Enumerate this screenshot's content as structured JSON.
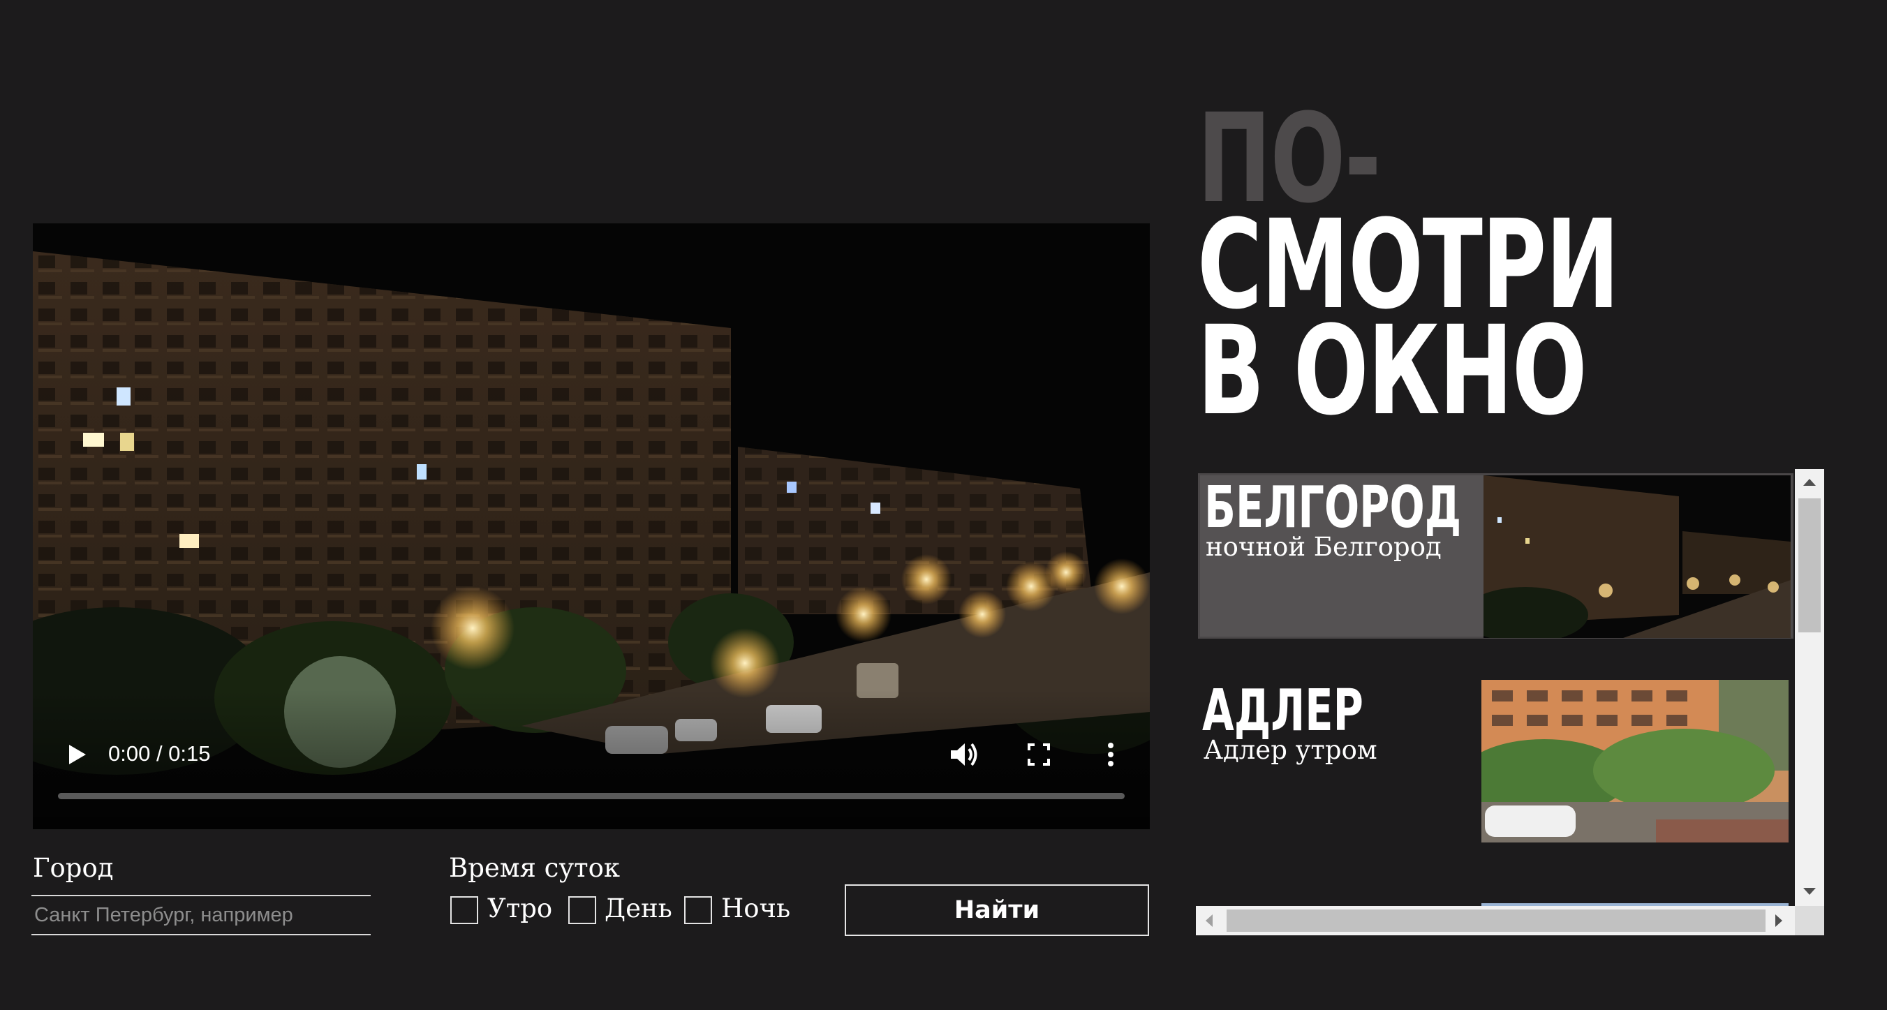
{
  "video": {
    "current_time": "0:00",
    "duration": "0:15",
    "time_display": "0:00 / 0:15",
    "progress": 0,
    "play_icon": "play-icon",
    "volume_icon": "volume-icon",
    "fullscreen_icon": "fullscreen-icon",
    "more_icon": "more-vertical-icon"
  },
  "search": {
    "city_label": "Город",
    "city_placeholder": "Санкт Петербург, например",
    "time_label": "Время суток",
    "options": [
      "Утро",
      "День",
      "Ночь"
    ],
    "checked": [
      false,
      false,
      false
    ],
    "submit_label": "Найти"
  },
  "title": {
    "line1": "ПО-",
    "line2": "СМОТРИ",
    "line3": "В ОКНО"
  },
  "cities": [
    {
      "name": "БЕЛГОРОД",
      "subtitle": "ночной Белгород",
      "active": true
    },
    {
      "name": "АДЛЕР",
      "subtitle": "Адлер утром",
      "active": false
    }
  ],
  "colors": {
    "background": "#1c1b1c",
    "title_muted": "#4d4a4b",
    "card_active": "#555253",
    "text": "#ffffff"
  }
}
